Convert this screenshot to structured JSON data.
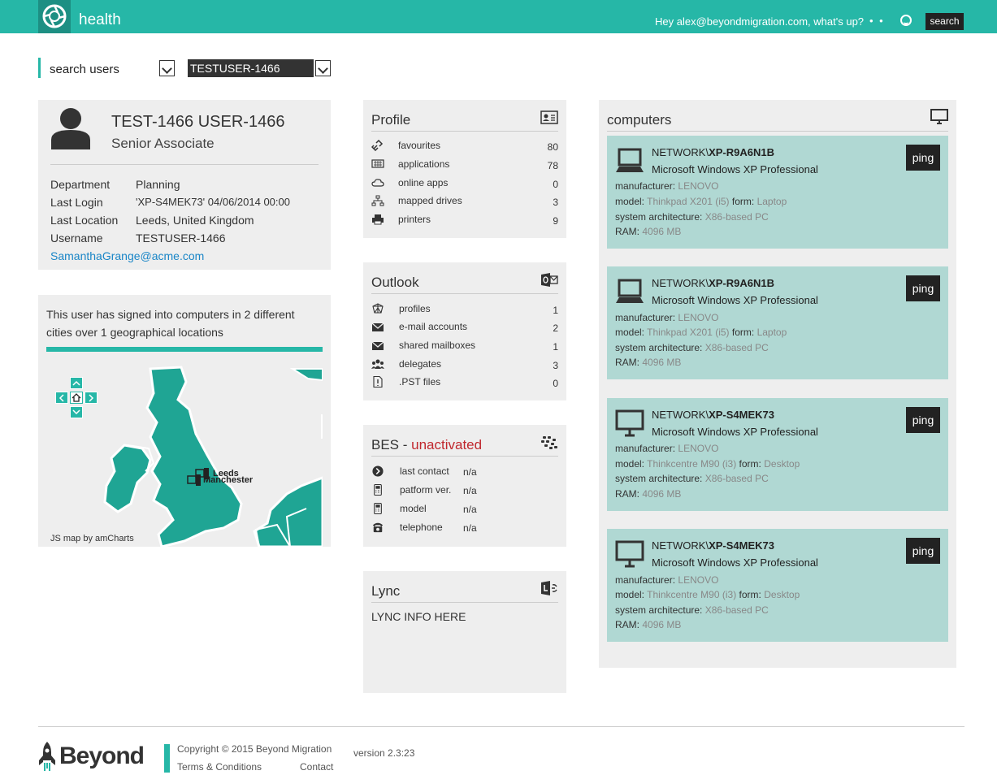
{
  "header": {
    "app_name": "health",
    "greeting": "Hey alex@beyondmigration.com, what's up?",
    "dots": "• •",
    "search_label": "search"
  },
  "search": {
    "label": "search users",
    "selected_user": "TESTUSER-1466"
  },
  "user": {
    "name": "TEST-1466 USER-1466",
    "title": "Senior Associate",
    "fields": [
      {
        "label": "Department",
        "value": "Planning"
      },
      {
        "label": "Last Login",
        "value": "'XP-S4MEK73' 04/06/2014 00:00"
      },
      {
        "label": "Last Location",
        "value": "Leeds, United Kingdom"
      },
      {
        "label": "Username",
        "value": "TESTUSER-1466"
      }
    ],
    "email": "SamanthaGrange@acme.com"
  },
  "map": {
    "summary": "This user has signed into computers in 2 different cities over 1 geographical locations",
    "city_1": "Leeds",
    "city_2": "Manchester",
    "credit": "JS map by amCharts"
  },
  "profile": {
    "title": "Profile",
    "items": [
      {
        "label": "favourites",
        "count": "80",
        "icon": "link-icon"
      },
      {
        "label": "applications",
        "count": "78",
        "icon": "keyboard-icon"
      },
      {
        "label": "online apps",
        "count": "0",
        "icon": "cloud-icon"
      },
      {
        "label": "mapped drives",
        "count": "3",
        "icon": "network-icon"
      },
      {
        "label": "printers",
        "count": "9",
        "icon": "printer-icon"
      }
    ]
  },
  "outlook": {
    "title": "Outlook",
    "items": [
      {
        "label": "profiles",
        "count": "1",
        "icon": "profiles-icon"
      },
      {
        "label": "e-mail accounts",
        "count": "2",
        "icon": "mail-icon"
      },
      {
        "label": "shared mailboxes",
        "count": "1",
        "icon": "mail-icon"
      },
      {
        "label": "delegates",
        "count": "3",
        "icon": "group-icon"
      },
      {
        "label": ".PST files",
        "count": "0",
        "icon": "file-icon"
      }
    ]
  },
  "bes": {
    "title": "BES - ",
    "status": "unactivated",
    "items": [
      {
        "label": "last contact",
        "value": "n/a",
        "icon": "chevron-circle-icon"
      },
      {
        "label": "patform ver.",
        "value": "n/a",
        "icon": "phone-icon"
      },
      {
        "label": "model",
        "value": "n/a",
        "icon": "phone-icon"
      },
      {
        "label": "telephone",
        "value": "n/a",
        "icon": "telephone-icon"
      }
    ]
  },
  "lync": {
    "title": "Lync",
    "body": "LYNC INFO HERE"
  },
  "computers": {
    "title": "computers",
    "ping_label": "ping",
    "labels": {
      "manufacturer": "manufacturer:",
      "model": "model:",
      "form": "form:",
      "arch": "system architecture:",
      "ram": "RAM:"
    },
    "items": [
      {
        "domain": "NETWORK\\",
        "host": "XP-R9A6N1B",
        "os": "Microsoft Windows XP Professional",
        "manufacturer": "LENOVO",
        "model": "Thinkpad X201 (i5)",
        "form": "Laptop",
        "arch": "X86-based PC",
        "ram": "4096 MB",
        "icon": "laptop-icon"
      },
      {
        "domain": "NETWORK\\",
        "host": "XP-R9A6N1B",
        "os": "Microsoft Windows XP Professional",
        "manufacturer": "LENOVO",
        "model": "Thinkpad X201 (i5)",
        "form": "Laptop",
        "arch": "X86-based PC",
        "ram": "4096 MB",
        "icon": "laptop-icon"
      },
      {
        "domain": "NETWORK\\",
        "host": "XP-S4MEK73",
        "os": "Microsoft Windows XP Professional",
        "manufacturer": "LENOVO",
        "model": "Thinkcentre M90 (i3)",
        "form": "Desktop",
        "arch": "X86-based PC",
        "ram": "4096 MB",
        "icon": "desktop-icon"
      },
      {
        "domain": "NETWORK\\",
        "host": "XP-S4MEK73",
        "os": "Microsoft Windows XP Professional",
        "manufacturer": "LENOVO",
        "model": "Thinkcentre M90 (i3)",
        "form": "Desktop",
        "arch": "X86-based PC",
        "ram": "4096 MB",
        "icon": "desktop-icon"
      }
    ]
  },
  "footer": {
    "brand": "Beyond",
    "copyright": "Copyright © 2015 Beyond Migration",
    "terms": "Terms & Conditions",
    "contact": "Contact",
    "version": "version 2.3:23"
  },
  "colors": {
    "accent": "#26b7a7",
    "card": "#b0d8d3",
    "panel": "#eeeeee",
    "alert": "#c0272d",
    "link": "#1a86c7"
  }
}
